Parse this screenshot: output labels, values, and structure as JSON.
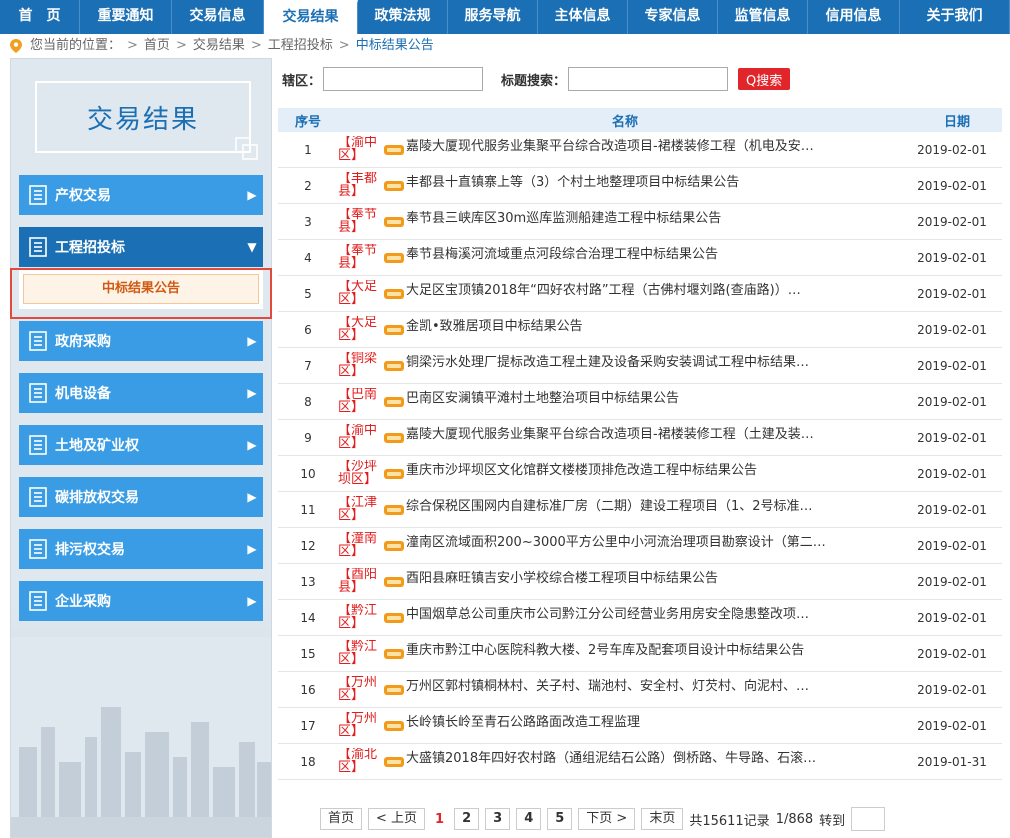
{
  "topnav": [
    "首　页",
    "重要通知",
    "交易信息",
    "交易结果",
    "政策法规",
    "服务导航",
    "主体信息",
    "专家信息",
    "监管信息",
    "信用信息",
    "关于我们"
  ],
  "topnav_active": 3,
  "breadcrumb": {
    "prefix": "您当前的位置：",
    "items": [
      "首页",
      "交易结果",
      "工程招投标"
    ],
    "current": "中标结果公告",
    "separator": ">"
  },
  "sidebar": {
    "title": "交易结果",
    "menu": [
      {
        "label": "产权交易",
        "arrow": "▶"
      },
      {
        "label": "工程招投标",
        "arrow": "▼"
      },
      {
        "label": "政府采购",
        "arrow": "▶"
      },
      {
        "label": "机电设备",
        "arrow": "▶"
      },
      {
        "label": "土地及矿业权",
        "arrow": "▶"
      },
      {
        "label": "碳排放权交易",
        "arrow": "▶"
      },
      {
        "label": "排污权交易",
        "arrow": "▶"
      },
      {
        "label": "企业采购",
        "arrow": "▶"
      }
    ],
    "submenu_active": "中标结果公告"
  },
  "filters": {
    "district_label": "辖区：",
    "district_value": "",
    "title_label": "标题搜索：",
    "title_value": "",
    "search_button": "Q搜索"
  },
  "table": {
    "headers": {
      "no": "序号",
      "name": "名称",
      "date": "日期"
    },
    "rows": [
      {
        "no": "1",
        "region": "【渝中区】",
        "title": "嘉陵大厦现代服务业集聚平台综合改造项目-裙楼装修工程（机电及安…",
        "date": "2019-02-01"
      },
      {
        "no": "2",
        "region": "【丰都县】",
        "title": "丰都县十直镇寨上等（3）个村土地整理项目中标结果公告",
        "date": "2019-02-01"
      },
      {
        "no": "3",
        "region": "【奉节县】",
        "title": "奉节县三峡库区30m巡库监测船建造工程中标结果公告",
        "date": "2019-02-01"
      },
      {
        "no": "4",
        "region": "【奉节县】",
        "title": "奉节县梅溪河流域重点河段综合治理工程中标结果公告",
        "date": "2019-02-01"
      },
      {
        "no": "5",
        "region": "【大足区】",
        "title": "大足区宝顶镇2018年“四好农村路”工程（古佛村堰刘路(查庙路)）…",
        "date": "2019-02-01"
      },
      {
        "no": "6",
        "region": "【大足区】",
        "title": "金凯•致雅居项目中标结果公告",
        "date": "2019-02-01"
      },
      {
        "no": "7",
        "region": "【铜梁区】",
        "title": "铜梁污水处理厂提标改造工程土建及设备采购安装调试工程中标结果…",
        "date": "2019-02-01"
      },
      {
        "no": "8",
        "region": "【巴南区】",
        "title": "巴南区安澜镇平滩村土地整治项目中标结果公告",
        "date": "2019-02-01"
      },
      {
        "no": "9",
        "region": "【渝中区】",
        "title": "嘉陵大厦现代服务业集聚平台综合改造项目-裙楼装修工程（土建及装…",
        "date": "2019-02-01"
      },
      {
        "no": "10",
        "region": "【沙坪坝区】",
        "title": "重庆市沙坪坝区文化馆群文楼楼顶排危改造工程中标结果公告",
        "date": "2019-02-01"
      },
      {
        "no": "11",
        "region": "【江津区】",
        "title": "综合保税区围网内自建标准厂房（二期）建设工程项目（1、2号标准…",
        "date": "2019-02-01"
      },
      {
        "no": "12",
        "region": "【潼南区】",
        "title": "潼南区流域面积200~3000平方公里中小河流治理项目勘察设计（第二…",
        "date": "2019-02-01"
      },
      {
        "no": "13",
        "region": "【酉阳县】",
        "title": "酉阳县麻旺镇吉安小学校综合楼工程项目中标结果公告",
        "date": "2019-02-01"
      },
      {
        "no": "14",
        "region": "【黔江区】",
        "title": "中国烟草总公司重庆市公司黔江分公司经营业务用房安全隐患整改项…",
        "date": "2019-02-01"
      },
      {
        "no": "15",
        "region": "【黔江区】",
        "title": "重庆市黔江中心医院科教大楼、2号车库及配套项目设计中标结果公告",
        "date": "2019-02-01"
      },
      {
        "no": "16",
        "region": "【万州区】",
        "title": "万州区郭村镇桐林村、关子村、瑞池村、安全村、灯芡村、向泥村、…",
        "date": "2019-02-01"
      },
      {
        "no": "17",
        "region": "【万州区】",
        "title": "长岭镇长岭至青石公路路面改造工程监理",
        "date": "2019-02-01"
      },
      {
        "no": "18",
        "region": "【渝北区】",
        "title": "大盛镇2018年四好农村路（通组泥结石公路）倒桥路、牛导路、石滚…",
        "date": "2019-01-31"
      }
    ]
  },
  "pagination": {
    "first": "首页",
    "prev": "< 上页",
    "current": "1",
    "pages": [
      "2",
      "3",
      "4",
      "5"
    ],
    "next": "下页 >",
    "last": "末页",
    "total": "共15611记录",
    "page_of": "1/868",
    "goto_label": "转到"
  },
  "colors": {
    "nav_blue": "#1b6fb4",
    "menu_blue": "#3a9ce4",
    "region_red": "#e21b1b",
    "search_red": "#e0262a",
    "highlight_red": "#e24a3b",
    "submenu_orange": "#d15a12"
  },
  "icons": {
    "location": "location-pin-icon",
    "menu_item": "document-list-icon",
    "new_badge": "new-badge-icon",
    "search": "search-icon"
  }
}
